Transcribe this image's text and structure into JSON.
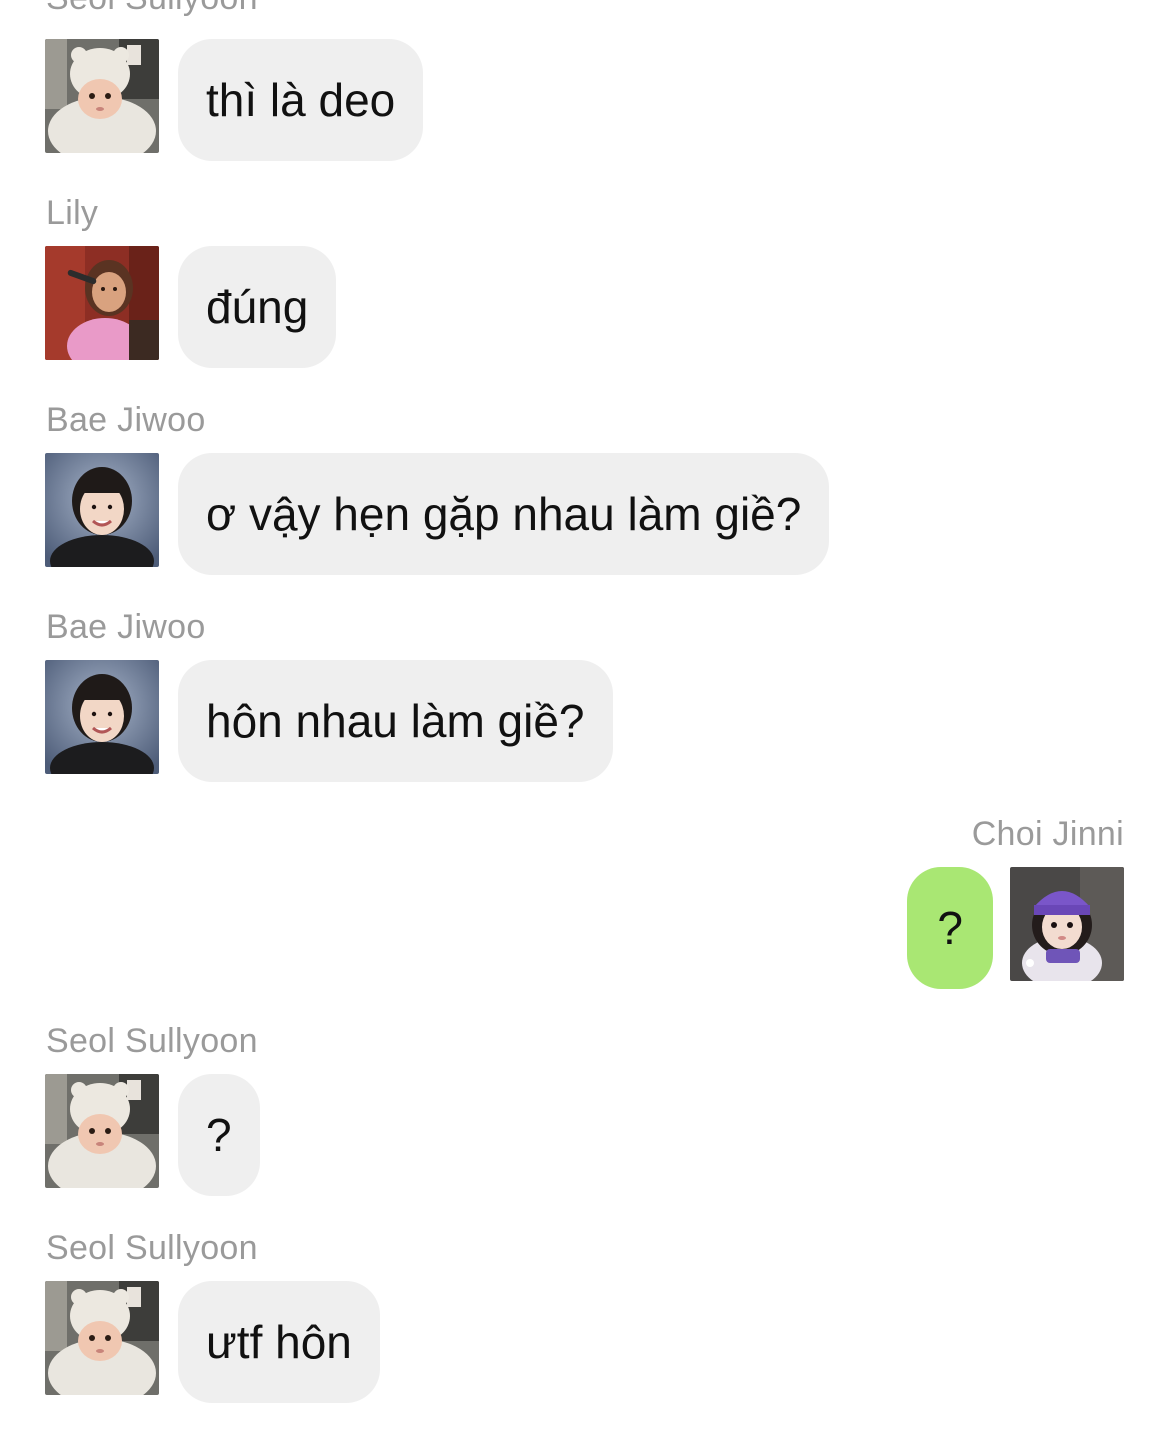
{
  "messages": [
    {
      "sender": "Seol Sullyoon",
      "avatar": "avatar-seol-sullyoon",
      "text": "thì là deo",
      "side": "left"
    },
    {
      "sender": "Lily",
      "avatar": "avatar-lily",
      "text": "đúng",
      "side": "left"
    },
    {
      "sender": "Bae Jiwoo",
      "avatar": "avatar-bae-jiwoo",
      "text": "ơ vậy hẹn gặp nhau làm giề?",
      "side": "left"
    },
    {
      "sender": "Bae Jiwoo",
      "avatar": "avatar-bae-jiwoo",
      "text": "hôn nhau làm giề?",
      "side": "left"
    },
    {
      "sender": "Choi Jinni",
      "avatar": "avatar-choi-jinni",
      "text": "?",
      "side": "right"
    },
    {
      "sender": "Seol Sullyoon",
      "avatar": "avatar-seol-sullyoon",
      "text": "?",
      "side": "left"
    },
    {
      "sender": "Seol Sullyoon",
      "avatar": "avatar-seol-sullyoon",
      "text": "ưtf hôn",
      "side": "left"
    }
  ],
  "colors": {
    "incoming_bubble": "#efefef",
    "outgoing_bubble": "#a9e773",
    "sender_name": "#9a9a9a",
    "message_text": "#111111"
  }
}
